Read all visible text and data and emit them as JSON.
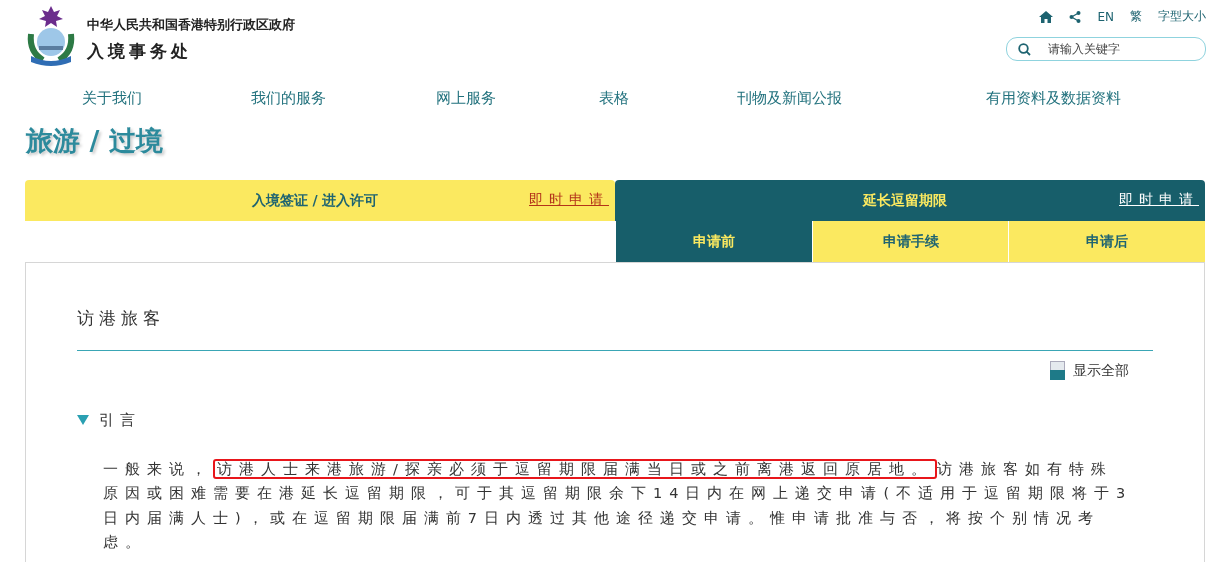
{
  "header": {
    "government": "中华人民共和国香港特别行政区政府",
    "department": "入境事务处",
    "utility_links": [
      "EN",
      "繁",
      "字型大小"
    ],
    "search": {
      "placeholder": "请输入关键字"
    }
  },
  "nav": {
    "items": [
      "关于我们",
      "我们的服务",
      "网上服务",
      "表格",
      "刊物及新闻公报",
      "有用资料及数据资料"
    ]
  },
  "page_title": "旅游 / 过境",
  "tabs": [
    {
      "label": "入境签证 / 进入许可",
      "link": "即时申请",
      "selected": false
    },
    {
      "label": "延长逗留期限",
      "link": "即时申请",
      "selected": true
    }
  ],
  "subtabs": [
    {
      "label": "申请前",
      "selected": true
    },
    {
      "label": "申请手续",
      "selected": false
    },
    {
      "label": "申请后",
      "selected": false
    }
  ],
  "section": {
    "title": "访港旅客",
    "show_all": "显示全部",
    "accordion": [
      {
        "title": "引言",
        "expanded": true,
        "paragraph": [
          {
            "text": "一般来说，",
            "highlighted": false
          },
          {
            "text": "访港人士来港旅游/探亲必须于逗留期限届满当日或之前离港返回原居地。",
            "highlighted": true
          },
          {
            "text": "访港旅客如有特殊原因或困难需要在港延长逗留期限，可于其逗留期限余下14日内在网上递交申请(不适用于逗留期限将于3日内届满人士)，或在逗留期限届满前7日内透过其他途径递交申请。惟申请批准与否，将按个别情况考虑。",
            "highlighted": false
          }
        ]
      }
    ]
  }
}
